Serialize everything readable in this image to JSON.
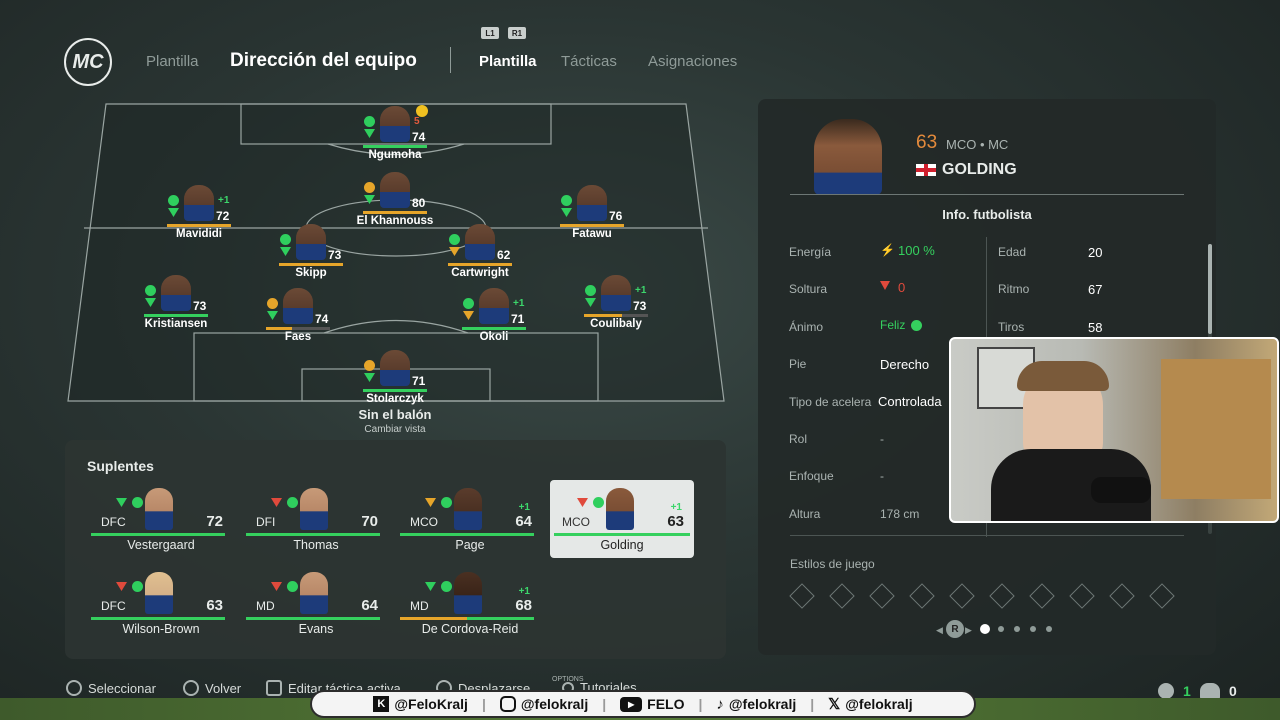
{
  "header": {
    "logo": "MC",
    "crumb": "Plantilla",
    "title": "Dirección del equipo",
    "tabs": [
      {
        "label": "Plantilla",
        "active": true
      },
      {
        "label": "Tácticas",
        "active": false
      },
      {
        "label": "Asignaciones",
        "active": false
      }
    ],
    "l1": "L1",
    "r1": "R1"
  },
  "formation": {
    "players": [
      {
        "name": "Ngumoha",
        "ovr": "74",
        "alert": "5"
      },
      {
        "name": "Mavididi",
        "ovr": "72",
        "plus": "+1"
      },
      {
        "name": "El Khannouss",
        "ovr": "80"
      },
      {
        "name": "Fatawu",
        "ovr": "76"
      },
      {
        "name": "Skipp",
        "ovr": "73"
      },
      {
        "name": "Cartwright",
        "ovr": "62"
      },
      {
        "name": "Kristiansen",
        "ovr": "73"
      },
      {
        "name": "Faes",
        "ovr": "74"
      },
      {
        "name": "Okoli",
        "ovr": "71",
        "plus": "+1"
      },
      {
        "name": "Coulibaly",
        "ovr": "73",
        "plus": "+1"
      },
      {
        "name": "Stolarczyk",
        "ovr": "71"
      }
    ],
    "mode": "Sin el balón",
    "change_view": "Cambiar vista"
  },
  "subs": {
    "title": "Suplentes",
    "cards": [
      {
        "pos": "DFC",
        "ovr": "72",
        "name": "Vestergaard"
      },
      {
        "pos": "DFI",
        "ovr": "70",
        "name": "Thomas"
      },
      {
        "pos": "MCO",
        "ovr": "64",
        "name": "Page",
        "plus": "+1"
      },
      {
        "pos": "MCO",
        "ovr": "63",
        "name": "Golding",
        "plus": "+1"
      },
      {
        "pos": "DFC",
        "ovr": "63",
        "name": "Wilson-Brown"
      },
      {
        "pos": "MD",
        "ovr": "64",
        "name": "Evans"
      },
      {
        "pos": "MD",
        "ovr": "68",
        "name": "De Cordova-Reid",
        "plus": "+1"
      }
    ]
  },
  "info": {
    "ovr": "63",
    "positions": "MCO • MC",
    "name": "GOLDING",
    "section": "Info. futbolista",
    "left_rows": [
      {
        "label": "Energía",
        "value": "100 %"
      },
      {
        "label": "Soltura",
        "value": "0"
      },
      {
        "label": "Ánimo",
        "value": "Feliz"
      },
      {
        "label": "Pie",
        "value": "Derecho"
      },
      {
        "label": "Tipo de acelera",
        "value": "Controlada"
      },
      {
        "label": "Rol",
        "value": "-"
      },
      {
        "label": "Enfoque",
        "value": "-"
      },
      {
        "label": "Altura",
        "value": "178 cm"
      }
    ],
    "right_rows": [
      {
        "label": "Edad",
        "value": "20"
      },
      {
        "label": "Ritmo",
        "value": "67"
      },
      {
        "label": "Tiros",
        "value": "58"
      }
    ],
    "playstyles": "Estilos de juego",
    "pager_btn": "R"
  },
  "footer": {
    "select": "Seleccionar",
    "back": "Volver",
    "edit": "Editar táctica activa",
    "scroll": "Desplazarse",
    "tutorials": "Tutoriales",
    "options": "OPTIONS",
    "count1": "1",
    "count2": "0"
  },
  "social": {
    "kick": "@FeloKralj",
    "instagram": "@felokralj",
    "youtube": "FELO",
    "tiktok": "@felokralj",
    "x": "@felokralj"
  },
  "colors": {
    "accent_green": "#35d05e",
    "ovr_orange": "#e38a3c",
    "card_selected": "#e5e8e7"
  }
}
